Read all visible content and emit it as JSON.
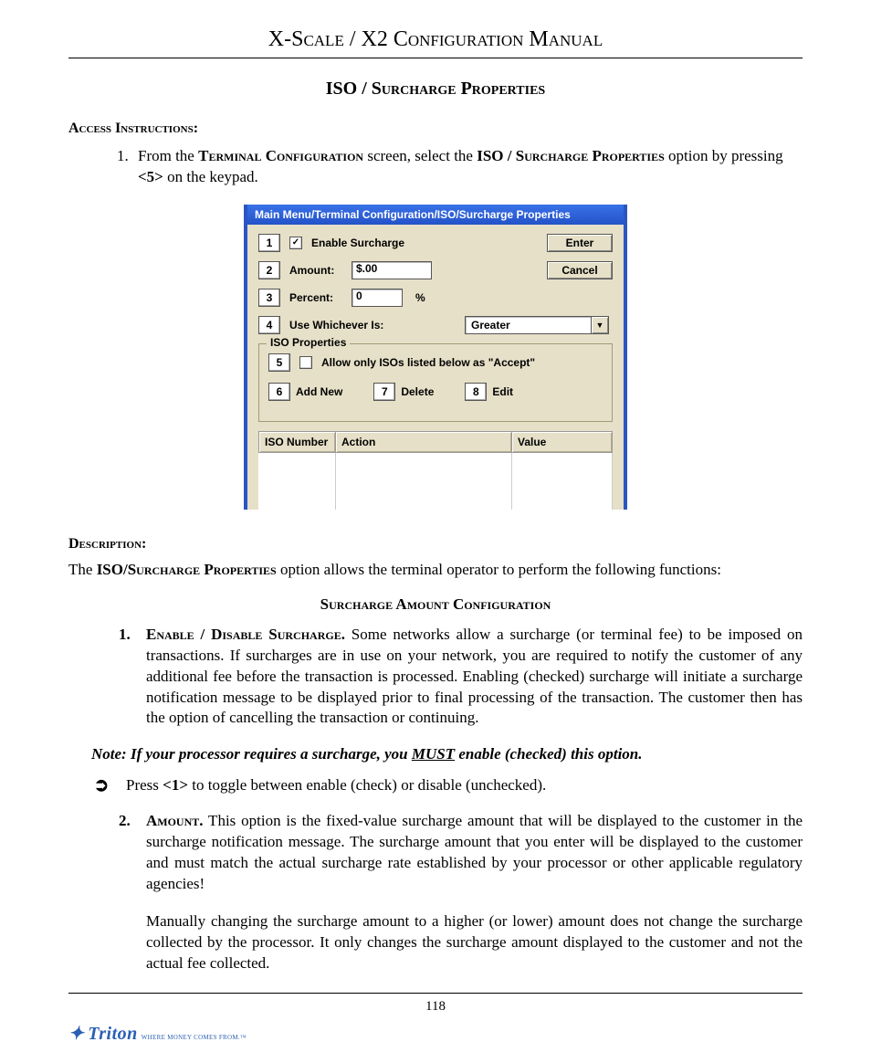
{
  "header": {
    "title_smallcaps": "X-Scale / X2 Configuration Manual"
  },
  "section": {
    "title": "ISO / Surcharge Properties",
    "access_heading": "Access Instructions:",
    "access_step_pre": "From the ",
    "access_step_term": "Terminal Configuration",
    "access_step_mid": " screen, select the ",
    "access_step_iso": "ISO / Surcharge Properties",
    "access_step_post": " option by pressing ",
    "access_step_key": "<5>",
    "access_step_tail": " on the keypad."
  },
  "dialog": {
    "title": "Main Menu/Terminal Configuration/ISO/Surcharge Properties",
    "keys": {
      "k1": "1",
      "k2": "2",
      "k3": "3",
      "k4": "4",
      "k5": "5",
      "k6": "6",
      "k7": "7",
      "k8": "8"
    },
    "enable_checked": "✓",
    "enable_label": "Enable Surcharge",
    "enter": "Enter",
    "cancel": "Cancel",
    "amount_label": "Amount:",
    "amount_value": "$.00",
    "percent_label": "Percent:",
    "percent_value": "0",
    "percent_sign": "%",
    "usewhich_label": "Use Whichever Is:",
    "usewhich_value": "Greater",
    "iso_legend": "ISO Properties",
    "allow_label": "Allow only ISOs listed below as \"Accept\"",
    "addnew": "Add New",
    "delete": "Delete",
    "edit": "Edit",
    "col_iso": "ISO Number",
    "col_action": "Action",
    "col_value": "Value"
  },
  "desc": {
    "heading": "Description:",
    "intro_pre": "The ",
    "intro_bold": "ISO/Surcharge Properties",
    "intro_post": " option allows the terminal operator to perform the following functions:",
    "sub_title": "Surcharge Amount Configuration",
    "item1_num": "1.",
    "item1_head": "Enable  / Disable Surcharge.",
    "item1_body": "   Some networks allow a surcharge (or terminal fee) to be imposed on transactions.  If surcharges are in use on your network, you are required to notify the customer of any additional fee before the transaction is processed.  Enabling (checked) surcharge will initiate a surcharge notification message to be displayed prior to final processing of the transaction.  The customer then has the option of cancelling the transaction or continuing.",
    "note_pre": "Note:  If your processor requires a surcharge, you ",
    "note_must": "MUST",
    "note_post": " enable (checked) this option.",
    "bullet_arrow": "➲",
    "bullet_pre": "Press ",
    "bullet_key": "<1>",
    "bullet_post": " to toggle between enable (check) or disable (unchecked).",
    "item2_num": "2.",
    "item2_head": "Amount.",
    "item2_body": "   This option is the fixed-value surcharge amount that will be displayed to the customer in the surcharge notification message.  The surcharge amount that you enter will be displayed to the customer and must match the actual surcharge rate established by your processor or other applicable regulatory agencies!",
    "item2_body2": "Manually changing the surcharge amount to a higher (or lower) amount does not change the surcharge collected by the processor.  It only changes the surcharge amount displayed to the customer and not the actual fee collected."
  },
  "footer": {
    "page": "118",
    "brand": "Triton",
    "tagline": "WHERE MONEY COMES FROM.™"
  }
}
